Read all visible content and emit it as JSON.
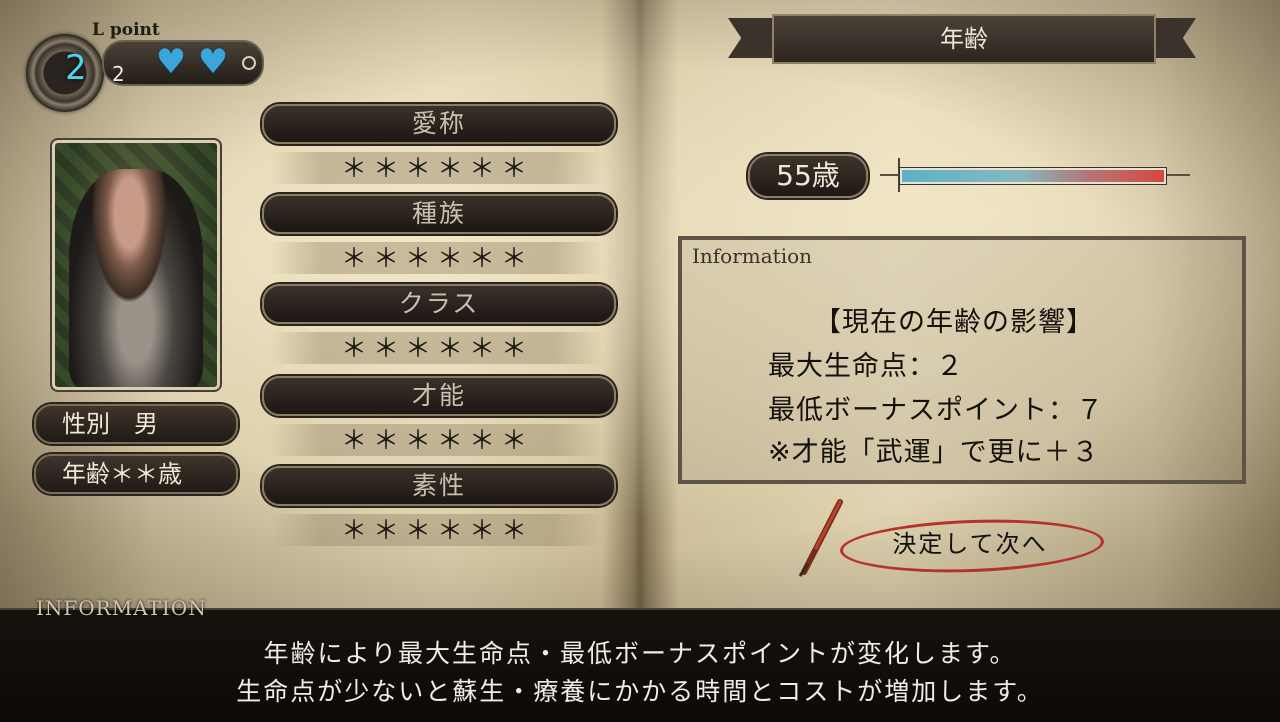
{
  "lpoint": {
    "title": "L point",
    "current": "2",
    "max": "2",
    "hearts_filled": 2,
    "heart_color": "#3aa6dc",
    "icon": "heart-icon"
  },
  "character": {
    "portrait_icon": "warrior-portrait",
    "gender": "性別　男",
    "age": "年齢＊＊歳"
  },
  "fields": [
    {
      "label": "愛称",
      "value": "＊＊＊＊＊＊"
    },
    {
      "label": "種族",
      "value": "＊＊＊＊＊＊"
    },
    {
      "label": "クラス",
      "value": "＊＊＊＊＊＊"
    },
    {
      "label": "才能",
      "value": "＊＊＊＊＊＊"
    },
    {
      "label": "素性",
      "value": "＊＊＊＊＊＊"
    }
  ],
  "right": {
    "section_title": "年齢",
    "age_value": "55歳",
    "age_slider_fraction": 0.95,
    "slider_colors": {
      "low": "#5db2c6",
      "high": "#d9463e"
    },
    "info": {
      "title": "Information",
      "heading": "【現在の年齢の影響】",
      "lines": [
        "最大生命点：２",
        "最低ボーナスポイント：７",
        "※才能「武運」で更に＋３"
      ]
    },
    "confirm_label": "決定して次へ",
    "confirm_ring_color": "#b5322b"
  },
  "bottom": {
    "title": "INFORMATION",
    "lines": [
      "年齢により最大生命点・最低ボーナスポイントが変化します。",
      "生命点が少ないと蘇生・療養にかかる時間とコストが増加します。"
    ]
  }
}
